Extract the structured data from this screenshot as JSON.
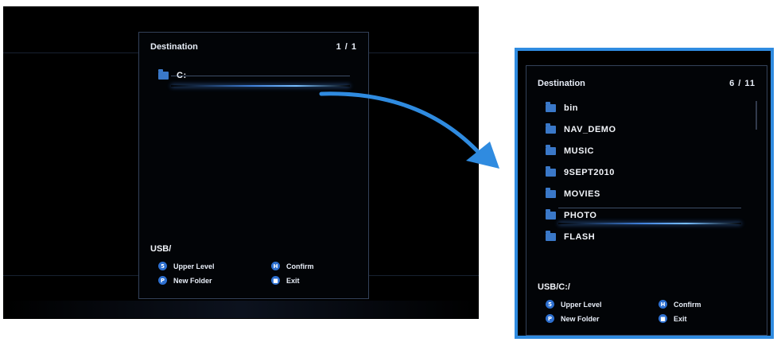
{
  "left_screen": {
    "title": "Destination",
    "count": "1 / 1",
    "items": [
      {
        "label": "C:",
        "selected": true
      }
    ],
    "path": "USB/",
    "hints": [
      {
        "icon": "5",
        "label": "Upper Level"
      },
      {
        "icon": "H",
        "label": "Confirm"
      },
      {
        "icon": "P",
        "label": "New Folder"
      },
      {
        "icon": "■",
        "label": "Exit"
      }
    ]
  },
  "right_screen": {
    "title": "Destination",
    "count": "6 / 11",
    "items": [
      {
        "label": "bin"
      },
      {
        "label": "NAV_DEMO"
      },
      {
        "label": "MUSIC"
      },
      {
        "label": "9SEPT2010"
      },
      {
        "label": "MOVIES"
      },
      {
        "label": "PHOTO",
        "selected": true
      },
      {
        "label": "FLASH"
      }
    ],
    "path": "USB/C:/",
    "hints": [
      {
        "icon": "5",
        "label": "Upper Level"
      },
      {
        "icon": "H",
        "label": "Confirm"
      },
      {
        "icon": "P",
        "label": "New Folder"
      },
      {
        "icon": "■",
        "label": "Exit"
      }
    ]
  },
  "colors": {
    "arrow": "#2f8be0",
    "highlight_border": "#2f8be0",
    "folder": "#3a78c8",
    "hint_icon": "#2d6fcf"
  },
  "icons": {
    "folder": "folder-icon",
    "upper_level": "upper-level-icon",
    "confirm": "confirm-icon",
    "new_folder": "new-folder-icon",
    "exit": "exit-icon",
    "arrow": "transition-arrow-icon"
  }
}
